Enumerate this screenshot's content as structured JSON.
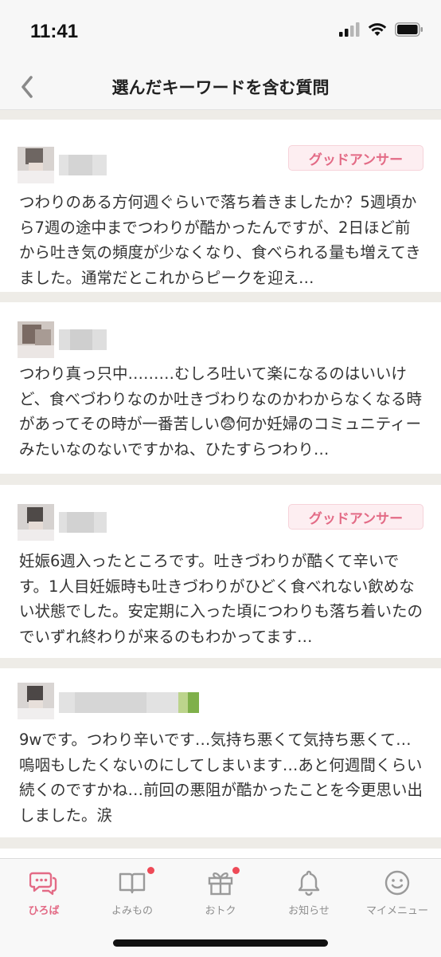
{
  "status_bar": {
    "time": "11:41"
  },
  "nav": {
    "title": "選んだキーワードを含む質問",
    "back_icon": "chevron-left-icon"
  },
  "posts": [
    {
      "badge": "グッドアンサー",
      "text": "つわりのある方何週ぐらいで落ち着きましたか？5週頃から7週の途中までつわりが酷かったんですが、2日ほど前から吐き気の頻度が少なくなり、食べられる量も増えてきました。通常だとこれからピークを迎え…"
    },
    {
      "badge": "",
      "text": "つわり真っ只中………むしろ吐いて楽になるのはいいけど、食べづわりなのか吐きづわりなのかわからなくなる時があってその時が一番苦しい😨何か妊婦のコミュニティーみたいなのないですかね、ひたすらつわり…"
    },
    {
      "badge": "グッドアンサー",
      "text": "妊娠6週入ったところです。吐きづわりが酷くて辛いです。1人目妊娠時も吐きづわりがひどく食べれない飲めない状態でした。安定期に入った頃につわりも落ち着いたのでいずれ終わりが来るのもわかってます…"
    },
    {
      "badge": "",
      "text": "9wです。つわり辛いです…気持ち悪くて気持ち悪くて…嗚咽もしたくないのにしてしまいます…あと何週間くらい続くのですかね…前回の悪阻が酷かったことを今更思い出しました。涙"
    }
  ],
  "tabs": [
    {
      "label": "ひろば",
      "icon": "chat-bubbles-icon",
      "active": true,
      "dot": false
    },
    {
      "label": "よみもの",
      "icon": "book-icon",
      "active": false,
      "dot": true
    },
    {
      "label": "おトク",
      "icon": "gift-icon",
      "active": false,
      "dot": true
    },
    {
      "label": "お知らせ",
      "icon": "bell-icon",
      "active": false,
      "dot": false
    },
    {
      "label": "マイメニュー",
      "icon": "smiley-face-icon",
      "active": false,
      "dot": false
    }
  ],
  "colors": {
    "accent": "#e36b86",
    "badge_bg": "#fdeef1",
    "feed_bg": "#eeece7",
    "notify_dot": "#ee4a57"
  }
}
